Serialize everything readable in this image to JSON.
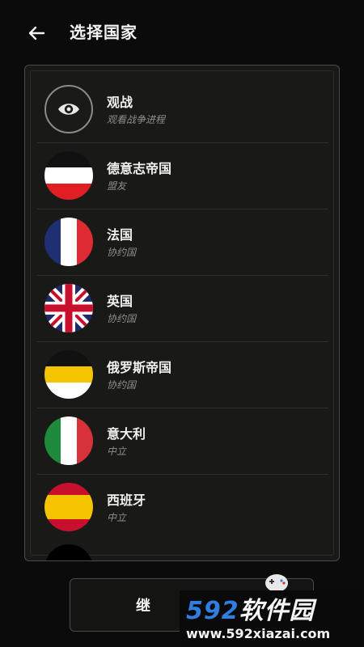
{
  "header": {
    "title": "选择国家",
    "back_icon": "arrow-left-icon"
  },
  "list": [
    {
      "key": "spectate",
      "name": "观战",
      "sub": "观看战争进程",
      "icon": "eye-icon"
    },
    {
      "key": "german-empire",
      "name": "德意志帝国",
      "sub": "盟友",
      "flag_colors": [
        "#111111",
        "#ffffff",
        "#e01e24"
      ]
    },
    {
      "key": "france",
      "name": "法国",
      "sub": "协约国",
      "flag_colors": [
        "#1e2f74",
        "#ffffff",
        "#e02b34"
      ]
    },
    {
      "key": "uk",
      "name": "英国",
      "sub": "协约国",
      "flag_colors": [
        "#1f2a6b",
        "#ffffff",
        "#c8102e"
      ]
    },
    {
      "key": "russian-empire",
      "name": "俄罗斯帝国",
      "sub": "协约国",
      "flag_colors": [
        "#111111",
        "#f5c400",
        "#ffffff"
      ]
    },
    {
      "key": "italy",
      "name": "意大利",
      "sub": "中立",
      "flag_colors": [
        "#1f8a3b",
        "#ffffff",
        "#d7313a"
      ]
    },
    {
      "key": "spain",
      "name": "西班牙",
      "sub": "中立",
      "flag_colors": [
        "#c8102e",
        "#f5c400",
        "#c8102e"
      ]
    }
  ],
  "footer": {
    "continue_label": "继"
  },
  "watermark": {
    "logo_num": "592",
    "logo_text": "软件园",
    "url": "www.592xiazai.com"
  }
}
